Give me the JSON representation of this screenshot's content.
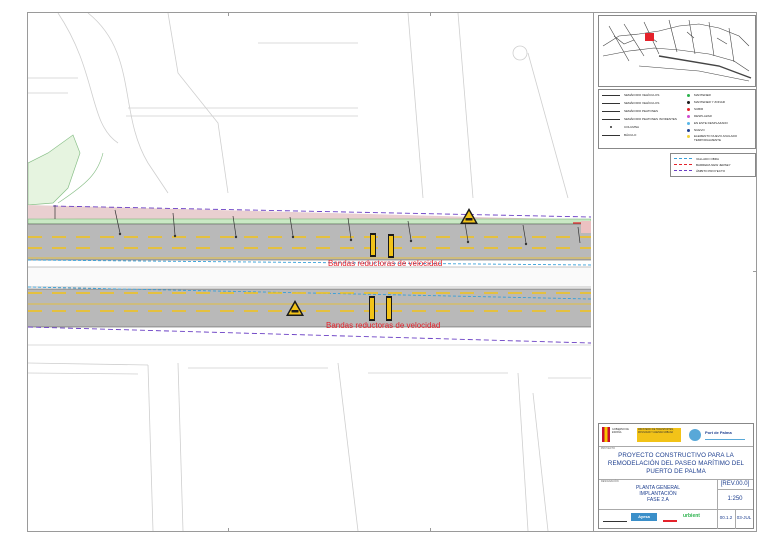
{
  "drawing": {
    "annotations": [
      "Bandas reductoras de velocidad",
      "Bandas reductoras de velocidad"
    ]
  },
  "legend": {
    "left_items": [
      "SEMÁFORO VEHÍCULOS",
      "SEMÁFORO VEHÍCULOS",
      "SEMÁFORO PEATONES",
      "SEMÁFORO PEATONES INVIDENTES",
      "COLUMNA",
      "BÁCULO"
    ],
    "right_items": [
      {
        "label": "MANTENER",
        "color": "#2bb24c"
      },
      {
        "label": "MANTENER Y ZONAR",
        "color": "#1a1a1a"
      },
      {
        "label": "SUBIR",
        "color": "#e4222b"
      },
      {
        "label": "DESPLAZAR",
        "color": "#d04bd0"
      },
      {
        "label": "EN ESTE DESPLAZADO",
        "color": "#58b6e8"
      },
      {
        "label": "NUEVO",
        "color": "#1e3f8f"
      },
      {
        "label": "ELEMENTO NUEVO ANULADO TEMPORALMENTE",
        "color": "#f2d43c"
      }
    ],
    "lines": [
      {
        "label": "VALLADO OBRA",
        "color": "#3aa0d8"
      },
      {
        "label": "BARRERA NEW JERSEY",
        "color": "#e4222b"
      },
      {
        "label": "ÁMBITO PROYECTO",
        "color": "#6a3fc4"
      }
    ]
  },
  "title_block": {
    "logos": [
      "GOBIERNO DE ESPAÑA",
      "MINISTERIO DE TRANSPORTES, MOVILIDAD Y AGENDA URBANA",
      "Port de Palma"
    ],
    "project_label": "PROYECTO",
    "project_title": "PROYECTO CONSTRUCTIVO PARA LA REMODELACIÓN DEL PASEO MARÍTIMO DEL PUERTO DE PALMA",
    "plan_label": "DESIGNACIÓN",
    "plan_title": [
      "PLANTA GENERAL",
      "IMPLANTACIÓN",
      "FASE 2.A"
    ],
    "rev": "[REV.00.0]",
    "scale": "1:250",
    "sheet": "00.1.2",
    "date": "03-JUL",
    "companies": [
      "Ayesa",
      "urbient"
    ]
  },
  "colors": {
    "road": "#b9b9b9",
    "sidewalk_pink": "#e9cfd0",
    "green_strip": "#c9e8c4",
    "lane_yellow": "#f2c318",
    "speed_red": "#e4222b",
    "boundary_purple": "#6a3fc4",
    "fence_blue": "#3aa0d8"
  }
}
